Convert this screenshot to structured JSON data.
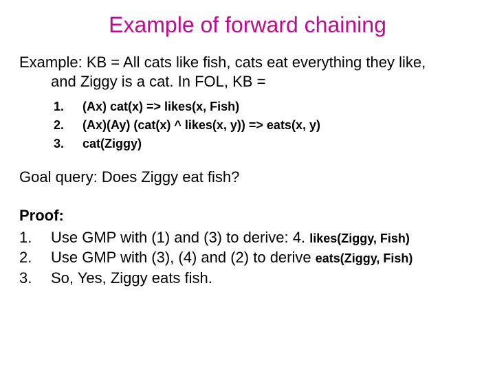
{
  "title": "Example of forward chaining",
  "intro_line1": "Example: KB = All cats like fish, cats eat everything they like,",
  "intro_line2": "and Ziggy is a cat. In FOL, KB =",
  "kb": [
    {
      "n": "1.",
      "text": "(Ax) cat(x) => likes(x, Fish)"
    },
    {
      "n": "2.",
      "text": "(Ax)(Ay) (cat(x) ^ likes(x, y)) => eats(x, y)"
    },
    {
      "n": "3.",
      "text": "cat(Ziggy)"
    }
  ],
  "goal": "Goal query: Does Ziggy eat fish?",
  "proof_label": "Proof:",
  "proof": [
    {
      "n": "1.",
      "text": "Use GMP with (1) and (3) to derive: 4. ",
      "tail": "likes(Ziggy, Fish)"
    },
    {
      "n": "2.",
      "text": "Use GMP with (3), (4) and (2) to derive ",
      "tail": "eats(Ziggy, Fish)"
    },
    {
      "n": "3.",
      "text": "So, Yes, Ziggy eats fish.",
      "tail": ""
    }
  ]
}
